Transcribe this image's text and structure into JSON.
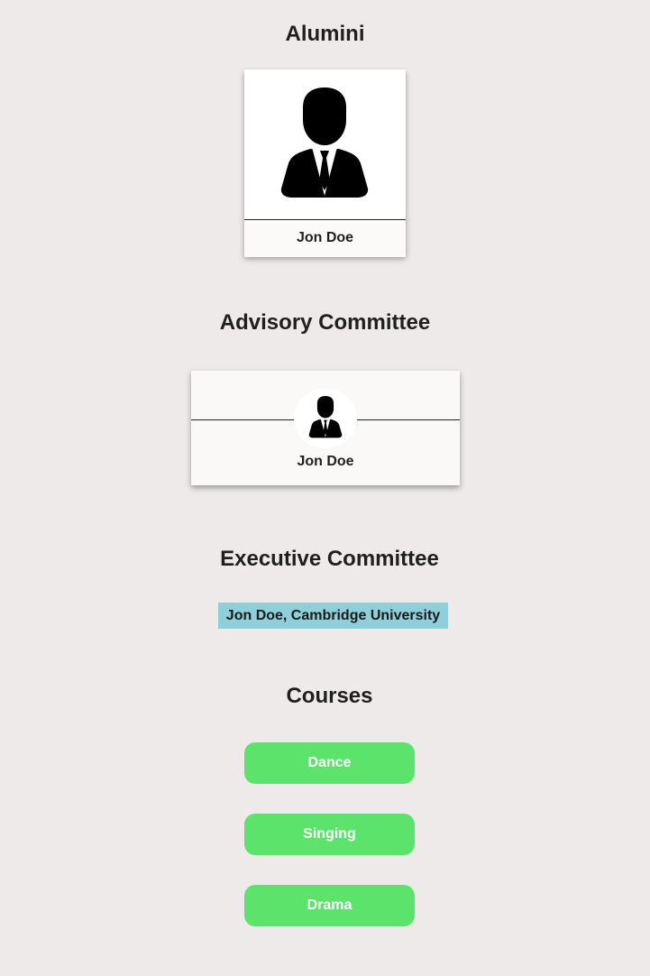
{
  "alumni": {
    "title": "Alumini",
    "card": {
      "name": "Jon Doe",
      "icon": "person-in-suit-icon"
    }
  },
  "advisory": {
    "title": "Advisory Committee",
    "card": {
      "name": "Jon Doe",
      "icon": "person-in-suit-icon"
    }
  },
  "executive": {
    "title": "Executive Committee",
    "tag": "Jon Doe, Cambridge University",
    "tag_color": "#8ecfd9"
  },
  "courses": {
    "title": "Courses",
    "button_color": "#5ce36c",
    "items": [
      {
        "label": "Dance"
      },
      {
        "label": "Singing"
      },
      {
        "label": "Drama"
      }
    ]
  }
}
